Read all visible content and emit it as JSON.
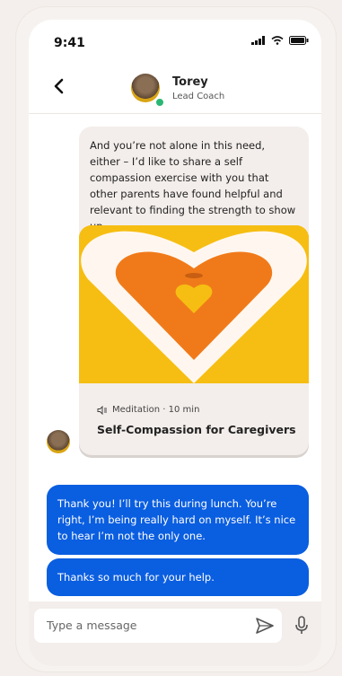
{
  "status": {
    "time": "9:41"
  },
  "header": {
    "name": "Torey",
    "role": "Lead Coach"
  },
  "messages": {
    "incoming_text": "And you’re not alone in this need, either – I’d like to share a self compassion exercise with you that other parents have found helpful and relevant to finding the strength to show up.",
    "card": {
      "meta": "Meditation · 10 min",
      "title": "Self-Compassion for Caregivers"
    },
    "outgoing1": "Thank you! I’ll try this during lunch. You’re right, I’m being really hard on myself. It’s nice to hear I’m not the only one.",
    "outgoing2": "Thanks so much for your help."
  },
  "composer": {
    "placeholder": "Type a message"
  },
  "colors": {
    "accent": "#0a5ee0",
    "card_bg": "#f5b90a",
    "heart_outer": "#f07a1a",
    "heart_inner": "#f5b90a"
  },
  "icons": [
    "back-chevron-icon",
    "signal-icon",
    "wifi-icon",
    "battery-icon",
    "speaker-icon",
    "send-icon",
    "microphone-icon"
  ]
}
